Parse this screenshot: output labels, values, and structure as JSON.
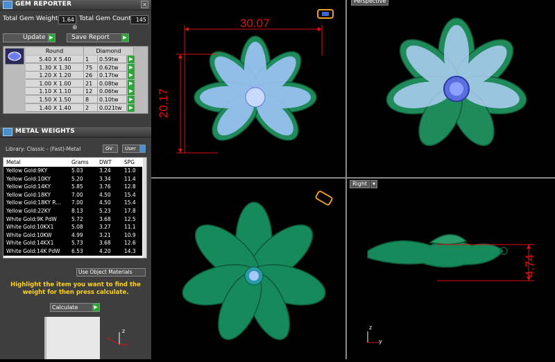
{
  "gem_reporter": {
    "title": "GEM REPORTER",
    "close_glyph": "×",
    "total_weight_label": "Total Gem Weight",
    "total_weight_value": "1.64",
    "total_count_label": "Total Gem Count",
    "total_count_value": "145",
    "collapse_glyph": "⊕",
    "update_label": "Update",
    "save_report_label": "Save Report",
    "columns": [
      "Round",
      "Diamond"
    ],
    "rows": [
      {
        "size": "5.40 X 5.40",
        "count": "1",
        "weight": "0.59tw"
      },
      {
        "size": "1.30 X 1.30",
        "count": "75",
        "weight": "0.62tw"
      },
      {
        "size": "1.20 X 1.20",
        "count": "26",
        "weight": "0.17tw"
      },
      {
        "size": "1.00 X 1.00",
        "count": "21",
        "weight": "0.08tw"
      },
      {
        "size": "1.10 X 1.10",
        "count": "12",
        "weight": "0.06tw"
      },
      {
        "size": "1.50 X 1.50",
        "count": "8",
        "weight": "0.10tw"
      },
      {
        "size": "1.40 X 1.40",
        "count": "2",
        "weight": "0.021tw"
      }
    ]
  },
  "metal_weights": {
    "title": "METAL WEIGHTS",
    "library_label": "Library: Classic - (Fast)-Metal",
    "gv_label": "GV",
    "user_label": "User",
    "columns": [
      "Metal",
      "Grams",
      "DWT",
      "SPG"
    ],
    "rows": [
      {
        "metal": "Yellow Gold:9KY",
        "grams": "5.03",
        "dwt": "3.24",
        "spg": "11.0"
      },
      {
        "metal": "Yellow Gold:10KY",
        "grams": "5.20",
        "dwt": "3.34",
        "spg": "11.4"
      },
      {
        "metal": "Yellow Gold:14KY",
        "grams": "5.85",
        "dwt": "3.76",
        "spg": "12.8"
      },
      {
        "metal": "Yellow Gold:18KY",
        "grams": "7.00",
        "dwt": "4.50",
        "spg": "15.4"
      },
      {
        "metal": "Yellow Gold:18KY R...",
        "grams": "7.00",
        "dwt": "4.50",
        "spg": "15.4"
      },
      {
        "metal": "Yellow Gold:22KY",
        "grams": "8.13",
        "dwt": "5.23",
        "spg": "17.8"
      },
      {
        "metal": "White Gold:9K PdW",
        "grams": "5.72",
        "dwt": "3.68",
        "spg": "12.5"
      },
      {
        "metal": "White Gold:10KX1",
        "grams": "5.08",
        "dwt": "3.27",
        "spg": "11.1"
      },
      {
        "metal": "White Gold:10KW",
        "grams": "4.99",
        "dwt": "3.21",
        "spg": "10.9"
      },
      {
        "metal": "White Gold:14KX1",
        "grams": "5.73",
        "dwt": "3.68",
        "spg": "12.6"
      },
      {
        "metal": "White Gold:14K PdW",
        "grams": "6.53",
        "dwt": "4.20",
        "spg": "14.3"
      }
    ],
    "use_object_materials": "Use Object Materials",
    "instruction": "Highlight the item you want to find the weight for then press calculate.",
    "calculate_label": "Calculate"
  },
  "viewports": {
    "top_left": {
      "width_dim": "30.07",
      "height_dim": "20.17"
    },
    "top_right": {
      "label": "Perspective"
    },
    "bottom_right": {
      "label": "Right",
      "dim": "4.74"
    },
    "axis": {
      "x": "x",
      "y": "y",
      "z": "z"
    }
  },
  "colors": {
    "accent_green": "#2fa53a",
    "dimension_red": "#e01010",
    "instruction_yellow": "#ffd21a",
    "gem_blue": "#a6c8ff",
    "metal_green": "#1f8a5a"
  }
}
